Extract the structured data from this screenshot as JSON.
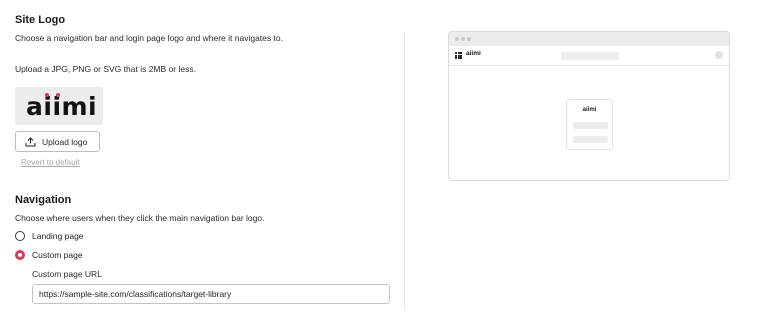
{
  "site_logo": {
    "title": "Site Logo",
    "description": "Choose a navigation bar and login page logo and where it navigates to.",
    "upload_hint": "Upload a JPG, PNG or SVG that is 2MB or less.",
    "logo_text": "aiimi",
    "logo_accent_color": "#d9375c",
    "upload_button_label": "Upload logo",
    "upload_icon": "upload-icon",
    "revert_label": "Revert to default"
  },
  "navigation": {
    "title": "Navigation",
    "description": "Choose where users when they click the main navigation bar logo.",
    "options": [
      {
        "label": "Landing page",
        "selected": false
      },
      {
        "label": "Custom page",
        "selected": true
      }
    ],
    "custom_url_label": "Custom page URL",
    "custom_url_value": "https://sample-site.com/classifications/target-library"
  },
  "preview": {
    "nav_logo_text": "aiimi",
    "card_logo_text": "aiimi",
    "grid_icon": "apps-grid-icon"
  },
  "colors": {
    "accent": "#d9375c",
    "muted_link": "#a8a8a8"
  }
}
